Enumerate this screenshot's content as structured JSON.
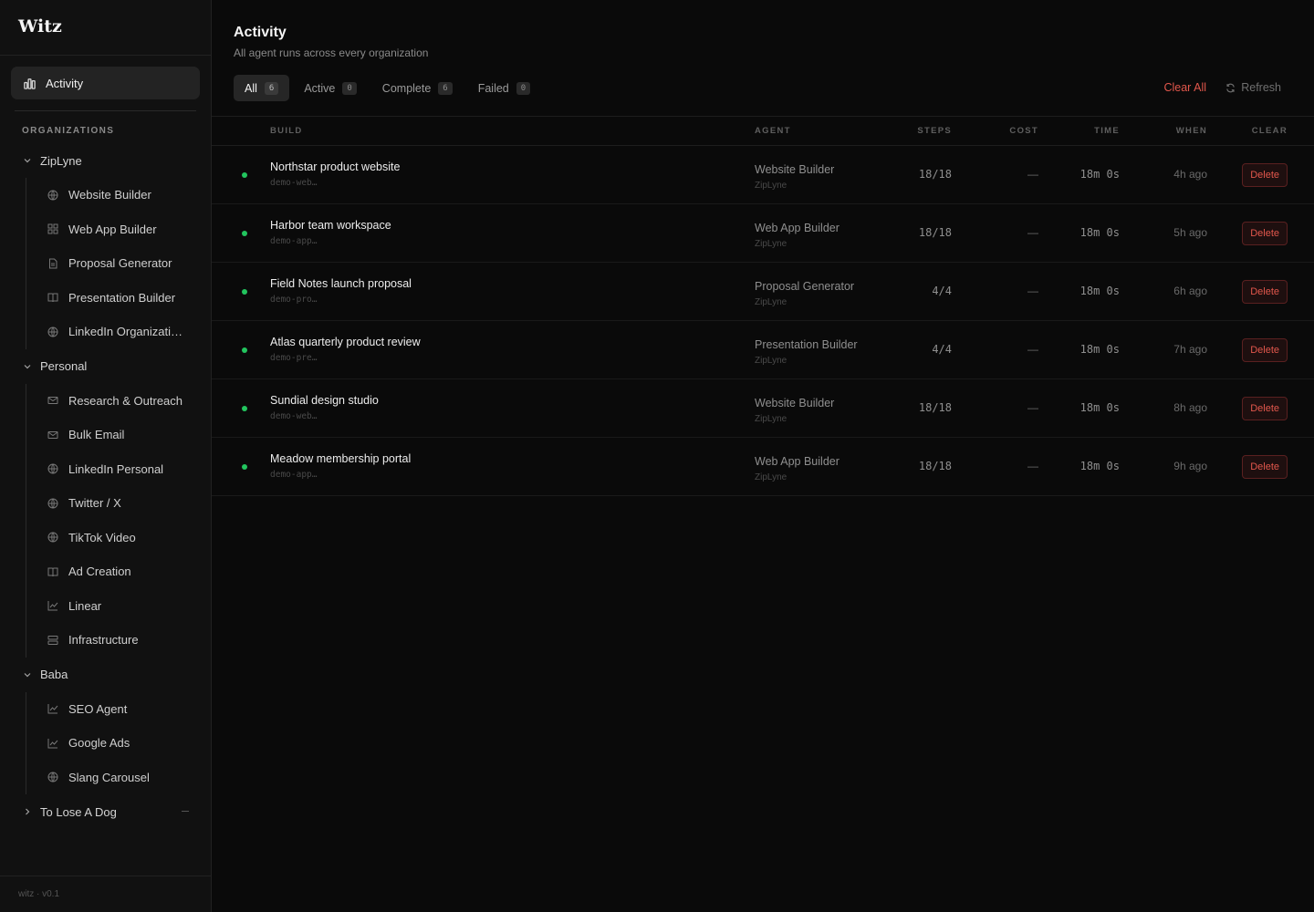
{
  "app": {
    "logo": "Witz",
    "version": "witz · v0.1"
  },
  "sidebar": {
    "activity_label": "Activity",
    "orgs_label": "ORGANIZATIONS",
    "orgs": [
      {
        "name": "ZipLyne",
        "expanded": true,
        "items": [
          {
            "label": "Website Builder",
            "icon": "globe-icon"
          },
          {
            "label": "Web App Builder",
            "icon": "app-grid-icon"
          },
          {
            "label": "Proposal Generator",
            "icon": "document-icon"
          },
          {
            "label": "Presentation Builder",
            "icon": "book-icon"
          },
          {
            "label": "LinkedIn Organizati…",
            "icon": "globe-icon"
          }
        ]
      },
      {
        "name": "Personal",
        "expanded": true,
        "items": [
          {
            "label": "Research & Outreach",
            "icon": "mail-icon"
          },
          {
            "label": "Bulk Email",
            "icon": "mail-icon"
          },
          {
            "label": "LinkedIn Personal",
            "icon": "globe-icon"
          },
          {
            "label": "Twitter / X",
            "icon": "globe-icon"
          },
          {
            "label": "TikTok Video",
            "icon": "globe-icon"
          },
          {
            "label": "Ad Creation",
            "icon": "book-icon"
          },
          {
            "label": "Linear",
            "icon": "chart-icon"
          },
          {
            "label": "Infrastructure",
            "icon": "server-icon"
          }
        ]
      },
      {
        "name": "Baba",
        "expanded": true,
        "items": [
          {
            "label": "SEO Agent",
            "icon": "chart-icon"
          },
          {
            "label": "Google Ads",
            "icon": "chart-icon"
          },
          {
            "label": "Slang Carousel",
            "icon": "globe-icon"
          }
        ]
      },
      {
        "name": "To Lose A Dog",
        "expanded": false,
        "items": []
      }
    ]
  },
  "header": {
    "title": "Activity",
    "subtitle": "All agent runs across every organization"
  },
  "tabs": [
    {
      "label": "All",
      "count": "6",
      "active": true
    },
    {
      "label": "Active",
      "count": "0",
      "active": false
    },
    {
      "label": "Complete",
      "count": "6",
      "active": false
    },
    {
      "label": "Failed",
      "count": "0",
      "active": false
    }
  ],
  "actions": {
    "clear_all": "Clear All",
    "refresh": "Refresh"
  },
  "table": {
    "columns": {
      "build": "BUILD",
      "agent": "AGENT",
      "steps": "STEPS",
      "cost": "COST",
      "time": "TIME",
      "when": "WHEN",
      "clear": "CLEAR"
    },
    "delete_label": "Delete",
    "status_color": "#22c55e",
    "rows": [
      {
        "title": "Northstar product website",
        "slug": "demo-web…",
        "agent": "Website Builder",
        "org": "ZipLyne",
        "steps": "18/18",
        "cost": "—",
        "time": "18m 0s",
        "when": "4h ago"
      },
      {
        "title": "Harbor team workspace",
        "slug": "demo-app…",
        "agent": "Web App Builder",
        "org": "ZipLyne",
        "steps": "18/18",
        "cost": "—",
        "time": "18m 0s",
        "when": "5h ago"
      },
      {
        "title": "Field Notes launch proposal",
        "slug": "demo-pro…",
        "agent": "Proposal Generator",
        "org": "ZipLyne",
        "steps": "4/4",
        "cost": "—",
        "time": "18m 0s",
        "when": "6h ago"
      },
      {
        "title": "Atlas quarterly product review",
        "slug": "demo-pre…",
        "agent": "Presentation Builder",
        "org": "ZipLyne",
        "steps": "4/4",
        "cost": "—",
        "time": "18m 0s",
        "when": "7h ago"
      },
      {
        "title": "Sundial design studio",
        "slug": "demo-web…",
        "agent": "Website Builder",
        "org": "ZipLyne",
        "steps": "18/18",
        "cost": "—",
        "time": "18m 0s",
        "when": "8h ago"
      },
      {
        "title": "Meadow membership portal",
        "slug": "demo-app…",
        "agent": "Web App Builder",
        "org": "ZipLyne",
        "steps": "18/18",
        "cost": "—",
        "time": "18m 0s",
        "when": "9h ago"
      }
    ]
  }
}
